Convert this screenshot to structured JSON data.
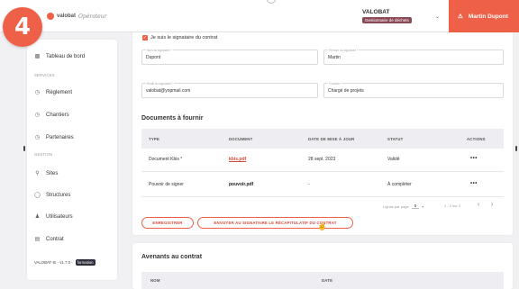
{
  "step_number": "4",
  "brand": {
    "name": "valobat",
    "tagline": "Opérateur"
  },
  "header": {
    "org_name": "VALOBAT",
    "org_role": "Gestionnaire de déchets",
    "user_name": "Martin Dupont"
  },
  "sidebar": {
    "items_top": [
      {
        "label": "Tableau de bord",
        "icon": "dashboard-icon"
      }
    ],
    "section_services": "SERVICES",
    "services": [
      {
        "label": "Règlement",
        "icon": "clock-icon"
      },
      {
        "label": "Chantiers",
        "icon": "clock-icon"
      },
      {
        "label": "Partenaires",
        "icon": "clock-icon"
      }
    ],
    "section_gestion": "GESTION",
    "gestion": [
      {
        "label": "Sites",
        "icon": "location-icon"
      },
      {
        "label": "Structures",
        "icon": "building-icon"
      },
      {
        "label": "Utilisateurs",
        "icon": "users-icon"
      },
      {
        "label": "Contrat",
        "icon": "document-icon"
      }
    ],
    "version": "VALOBAT-SI - v1.7.0 -",
    "version_badge": "formation"
  },
  "contract": {
    "signatory_checkbox_label": "Je suis le signataire du contrat",
    "fields": {
      "lastname": {
        "label": "Nom du signataire *",
        "value": "Dupont"
      },
      "firstname": {
        "label": "Prénom du signataire *",
        "value": "Martin"
      },
      "email": {
        "label": "Email du signataire *",
        "value": "valobat@yopmail.com"
      },
      "function": {
        "label": "Fonction *",
        "value": "Chargé de projets"
      }
    }
  },
  "documents": {
    "title": "Documents à fournir",
    "columns": [
      "TYPE",
      "DOCUMENT",
      "DATE DE MISE À JOUR",
      "STATUT",
      "ACTIONS"
    ],
    "rows": [
      {
        "type": "Document Kbis *",
        "document": "kbis.pdf",
        "date": "28 sept. 2023",
        "status": "Validé",
        "actions": "•••"
      },
      {
        "type": "Pouvoir de signer",
        "document": "pouvoir.pdf",
        "date": "-",
        "status": "À compléter",
        "actions": "•••"
      }
    ],
    "pagination": {
      "rows_per_page_label": "Lignes par page",
      "rows_per_page": "5",
      "range": "1 - 2 sur 2"
    }
  },
  "buttons": {
    "save": "ENREGISTRER",
    "send": "ENVOYER AU SIGNATAIRE LE RÉCAPITULATIF DU CONTRAT"
  },
  "amendments": {
    "title": "Avenants au contrat",
    "columns": [
      "NOM",
      "DATE"
    ]
  },
  "colors": {
    "accent": "#ee6148",
    "role_badge": "#8a4a55"
  }
}
